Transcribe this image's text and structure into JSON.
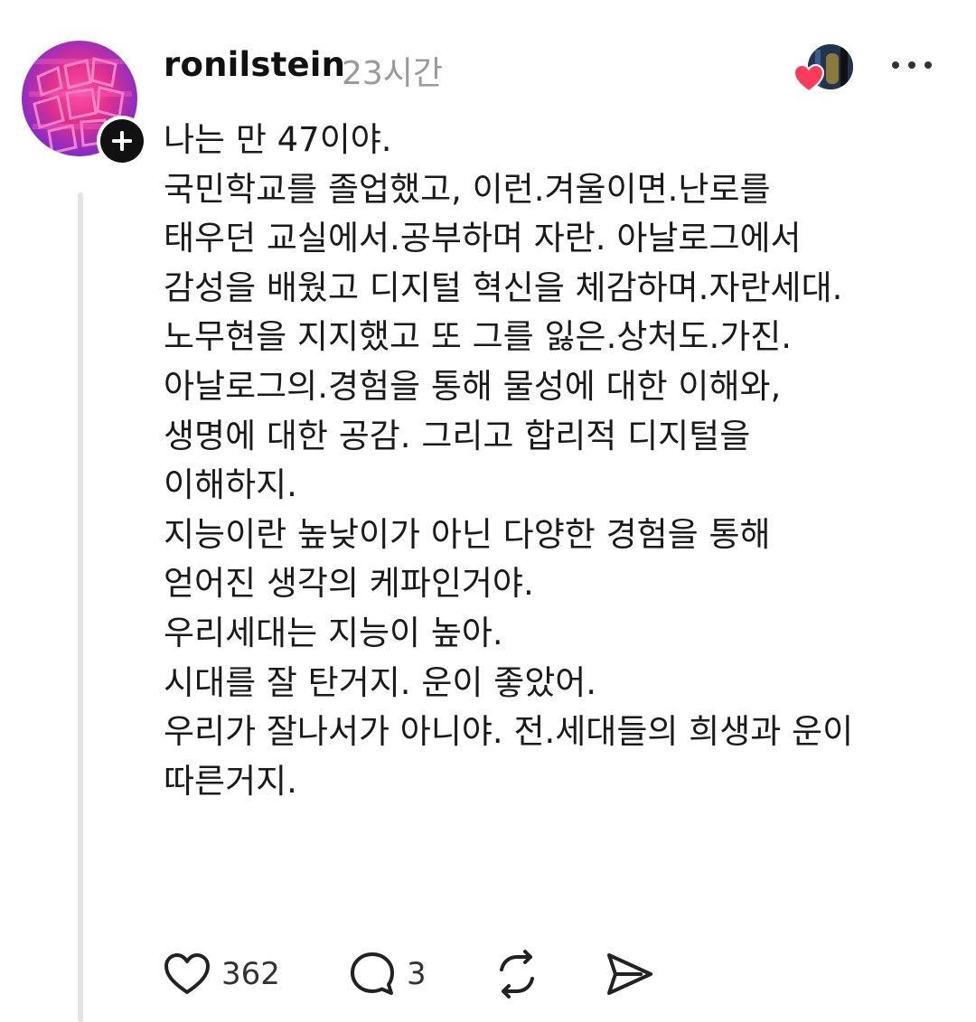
{
  "post": {
    "username": "ronilstein",
    "time": "23시간",
    "avatar_icon": "abstract-pink-avatar",
    "follow_icon": "plus-icon",
    "liked_by_icon": "heart-icon",
    "more_icon": "ellipsis-icon",
    "lines": [
      "나는 만 47이야.",
      "국민학교를 졸업했고, 이런.겨울이면.난로를",
      "태우던 교실에서.공부하며 자란. 아날로그에서",
      "감성을 배웠고 디지털 혁신을 체감하며.자란세대.",
      "노무현을 지지했고 또 그를 잃은.상처도.가진.",
      "아날로그의.경험을 통해 물성에 대한 이해와,",
      "생명에 대한 공감. 그리고 합리적 디지털을",
      "이해하지.",
      "지능이란 높낮이가 아닌 다양한 경험을 통해",
      "얻어진 생각의 케파인거야.",
      "우리세대는 지능이 높아.",
      "시대를 잘 탄거지. 운이 좋았어.",
      "우리가 잘나서가 아니야. 전.세대들의 희생과 운이",
      "따른거지."
    ]
  },
  "actions": {
    "like_icon": "heart-outline-icon",
    "like_count": "362",
    "comment_icon": "speech-bubble-icon",
    "comment_count": "3",
    "repost_icon": "repost-icon",
    "share_icon": "send-icon"
  },
  "colors": {
    "text": "#111111",
    "muted": "#9a9a9a",
    "heart": "#ff3b5c",
    "thread_line": "#e4e4e4"
  }
}
